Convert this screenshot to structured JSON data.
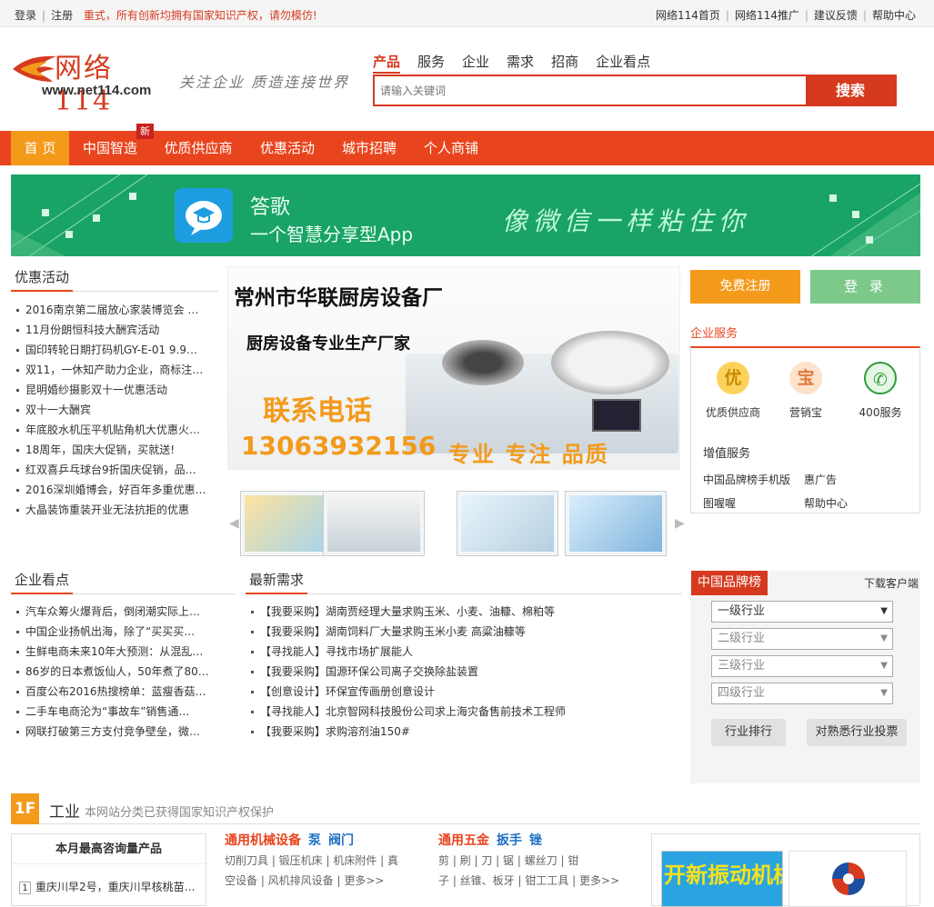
{
  "topbar": {
    "login": "登录",
    "register": "注册",
    "notice": "重式，所有创新均拥有国家知识产权，请勿模仿!",
    "links": [
      "网络114首页",
      "网络114推广",
      "建议反馈",
      "帮助中心"
    ]
  },
  "header": {
    "logo_cn": "网络114",
    "logo_url": "www.net114.com",
    "slogan": "关注企业 质造连接世界",
    "search_tabs": [
      "产品",
      "服务",
      "企业",
      "需求",
      "招商",
      "企业看点"
    ],
    "search_placeholder": "请输入关键词",
    "search_button": "搜索"
  },
  "nav": {
    "items": [
      "首 页",
      "中国智造",
      "优质供应商",
      "优惠活动",
      "城市招聘",
      "个人商铺"
    ],
    "new_tag": "新"
  },
  "banner": {
    "app_name": "答歌",
    "app_tagline": "一个智慧分享型App",
    "slogan": "像微信一样粘住你"
  },
  "promotions": {
    "title": "优惠活动",
    "items": [
      "2016南京第二届放心家装博览会 …",
      "11月份朗恒科技大酬宾活动",
      "国印转轮日期打码机GY-E-01 9.9…",
      "双11，一休知产助力企业，商标注…",
      "昆明婚纱摄影双十一优惠活动",
      "双十一大酬宾",
      "年底胶水机压平机贴角机大优惠火…",
      "18周年，国庆大促销，买就送!",
      "红双喜乒乓球台9折国庆促销，品…",
      "2016深圳婚博会，好百年多重优惠…",
      "大晶装饰重装开业无法抗拒的优惠"
    ]
  },
  "main_promo": {
    "company": "常州市华联厨房设备厂",
    "tagline": "厨房设备专业生产厂家",
    "contact_label": "联系电话",
    "phone": "13063932156",
    "motto": "专业 专注 品质"
  },
  "thumbnails": [
    {
      "caption": "thumb-1"
    },
    {
      "caption": "thumb-2"
    },
    {
      "caption": "thumb-3"
    },
    {
      "caption": "thumb-4"
    }
  ],
  "account": {
    "register_button": "免费注册",
    "login_button": "登 录"
  },
  "enterprise_services": {
    "title": "企业服务",
    "services": [
      {
        "icon": "优",
        "label": "优质供应商"
      },
      {
        "icon": "宝",
        "label": "营销宝"
      },
      {
        "icon": "✆",
        "label": "400服务"
      }
    ],
    "value_added_title": "增值服务",
    "value_added": [
      "中国品牌榜手机版",
      "惠广告",
      "图喔喔",
      "帮助中心"
    ]
  },
  "enterprise_news": {
    "title": "企业看点",
    "items": [
      "汽车众筹火爆背后，倒闭潮实际上…",
      "中国企业扬帆出海，除了“买买买…",
      "生鲜电商未来10年大预测：从混乱…",
      "86岁的日本煮饭仙人，50年煮了80…",
      "百度公布2016热搜榜单：蓝瘦香菇…",
      "二手车电商沦为“事故车”销售通…",
      "网联打破第三方支付竞争壁垒，微…"
    ]
  },
  "latest_demands": {
    "title": "最新需求",
    "items": [
      {
        "tag": "【我要采购】",
        "text": "湖南贾经理大量求购玉米、小麦、油糠、棉粕等"
      },
      {
        "tag": "【我要采购】",
        "text": "湖南饲料厂大量求购玉米小麦 高粱油糠等"
      },
      {
        "tag": "【寻找能人】",
        "text": "寻找市场扩展能人"
      },
      {
        "tag": "【我要采购】",
        "text": "国源环保公司离子交换除盐装置"
      },
      {
        "tag": "【创意设计】",
        "text": "环保宣传画册创意设计"
      },
      {
        "tag": "【寻找能人】",
        "text": "北京智网科技股份公司求上海灾备售前技术工程师"
      },
      {
        "tag": "【我要采购】",
        "text": "求购溶剂油150#"
      }
    ]
  },
  "brand_ranking": {
    "tab": "中国品牌榜",
    "download": "下载客户端",
    "selects": [
      "一级行业",
      "二级行业",
      "三级行业",
      "四级行业"
    ],
    "rank_button": "行业排行",
    "vote_button": "对熟悉行业投票"
  },
  "floor": {
    "number": "1F",
    "name": "工业",
    "desc": "本网站分类已获得国家知识产权保护"
  },
  "top_products": {
    "title": "本月最高咨询量产品",
    "first_rank": "1",
    "first_item": "重庆川早2号，重庆川早核桃苗…"
  },
  "categories": [
    {
      "title": "通用机械设备",
      "subs": [
        "泵",
        "阀门"
      ],
      "lines": [
        "切削刀具 | 锻压机床 | 机床附件 | 真",
        "空设备 | 风机排风设备 | 更多>>"
      ]
    },
    {
      "title": "通用五金",
      "subs": [
        "扳手",
        "锉"
      ],
      "lines": [
        "剪 | 刷 | 刀 | 锯 | 螺丝刀 | 钳",
        "子 | 丝锥、板牙 | 钳工工具 | 更多>>"
      ]
    }
  ],
  "ad": {
    "text": "开新振动机械"
  },
  "colors": {
    "brand_red": "#d63a1e",
    "nav_red": "#e8451e",
    "orange": "#f39a1b",
    "banner_green": "#1aa366"
  }
}
